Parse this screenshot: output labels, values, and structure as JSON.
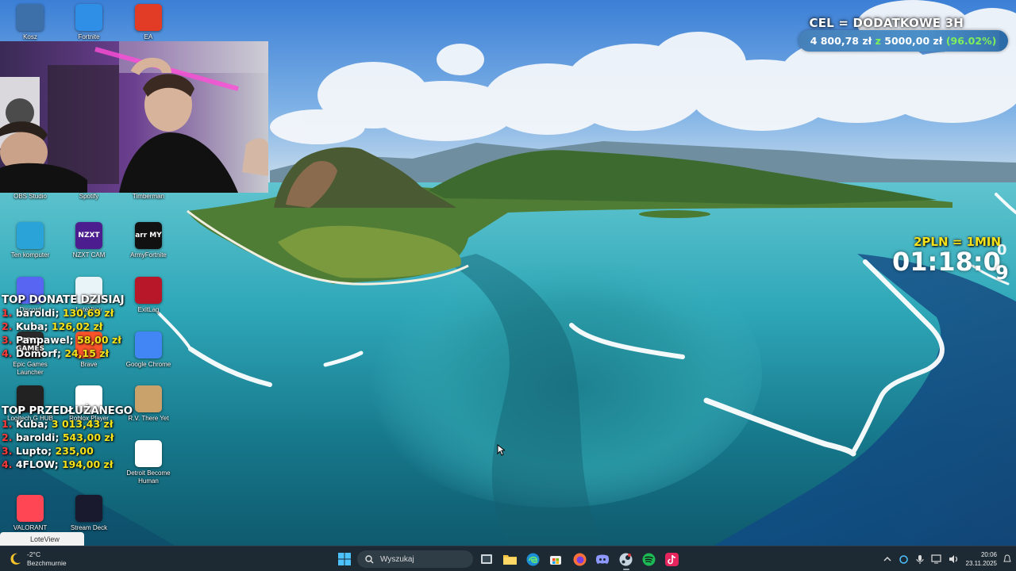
{
  "desktop_icons": [
    {
      "label": "Kosz",
      "icon": "recycle-bin-icon",
      "color": "#3d6fa8"
    },
    {
      "label": "Fortnite",
      "icon": "fortnite-icon",
      "color": "#2f8fe6"
    },
    {
      "label": "EA",
      "icon": "ea-icon",
      "color": "#e23b26"
    },
    {
      "label": "OBS Studio",
      "icon": "obs-icon",
      "color": "#302e31"
    },
    {
      "label": "Spotify",
      "icon": "spotify-icon",
      "color": "#1db954"
    },
    {
      "label": "Timberman",
      "icon": "timberman-icon",
      "color": "#6b3f1e"
    },
    {
      "label": "Ten komputer",
      "icon": "this-pc-icon",
      "color": "#2aa3d8"
    },
    {
      "label": "NZXT CAM",
      "icon": "nzxt-icon",
      "color": "#4b1d8f",
      "text": "NZXT"
    },
    {
      "label": "ArmyFortnite",
      "icon": "armyfortnite-icon",
      "color": "#111111",
      "text": "arr MY"
    },
    {
      "label": "Discord",
      "icon": "discord-icon",
      "color": "#5865f2"
    },
    {
      "label": "LoteView",
      "icon": "loteview-icon",
      "color": "#e9f4f8"
    },
    {
      "label": "ExitLag",
      "icon": "exitlag-icon",
      "color": "#b8172a"
    },
    {
      "label": "Epic Games Launcher",
      "icon": "epic-games-icon",
      "color": "#2a2a2a",
      "text": "EPIC GAMES"
    },
    {
      "label": "Brave",
      "icon": "brave-icon",
      "color": "#fb542b"
    },
    {
      "label": "Google Chrome",
      "icon": "chrome-icon",
      "color": "#4285f4"
    },
    {
      "label": "Logitech G HUB",
      "icon": "logitech-icon",
      "color": "#222222"
    },
    {
      "label": "Roblox Player",
      "icon": "roblox-icon",
      "color": "#ffffff"
    },
    {
      "label": "R.V. There Yet",
      "icon": "rv-there-yet-icon",
      "color": "#c9a26b"
    },
    {
      "label": "Detroit Become Human",
      "icon": "detroit-icon",
      "color": "#ffffff"
    },
    {
      "label": "VALORANT",
      "icon": "valorant-icon",
      "color": "#ff4655"
    },
    {
      "label": "Stream Deck",
      "icon": "stream-deck-icon",
      "color": "#1a1a2e"
    }
  ],
  "goal": {
    "title": "CEL = DODATKOWE 3H",
    "current": "4 800,78 zł",
    "separator": "z",
    "target": "5000,00 zł",
    "percent_label": "(96.02%)",
    "progress": 0.9602
  },
  "timer": {
    "rate": "2PLN = 1MIN",
    "value": "01:18:0",
    "rolling_digit": "9"
  },
  "top_donate": {
    "title": "TOP DONATE DZISIAJ",
    "rows": [
      {
        "rank": "1.",
        "name": "baroldi;",
        "amount": "130,69 zł"
      },
      {
        "rank": "2.",
        "name": "Kuba;",
        "amount": "126,02 zł"
      },
      {
        "rank": "3.",
        "name": "Panpawel;",
        "amount": "58,00 zł"
      },
      {
        "rank": "4.",
        "name": "Domorf;",
        "amount": "24,15 zł"
      }
    ]
  },
  "top_extended": {
    "title": "TOP PRZEDŁUŻANEGO",
    "rows": [
      {
        "rank": "1.",
        "name": "Kuba;",
        "amount": "3 013,43 zł"
      },
      {
        "rank": "2.",
        "name": "baroldi;",
        "amount": "543,00 zł"
      },
      {
        "rank": "3.",
        "name": "Lupto;",
        "amount": "235,00"
      },
      {
        "rank": "4.",
        "name": "4FLOW;",
        "amount": "194,00 zł"
      }
    ]
  },
  "toast": {
    "label": "LoteView"
  },
  "taskbar": {
    "weather_temp": "-2°C",
    "weather_desc": "Bezchmurnie",
    "search_placeholder": "Wyszukaj",
    "apps": [
      "start-icon",
      "task-view-icon",
      "file-explorer-icon",
      "edge-icon",
      "store-icon",
      "firefox-icon",
      "discord-icon",
      "steam-icon",
      "spotify-icon",
      "tiktok-icon"
    ],
    "time": "20:06",
    "date": "23.11.2025"
  }
}
